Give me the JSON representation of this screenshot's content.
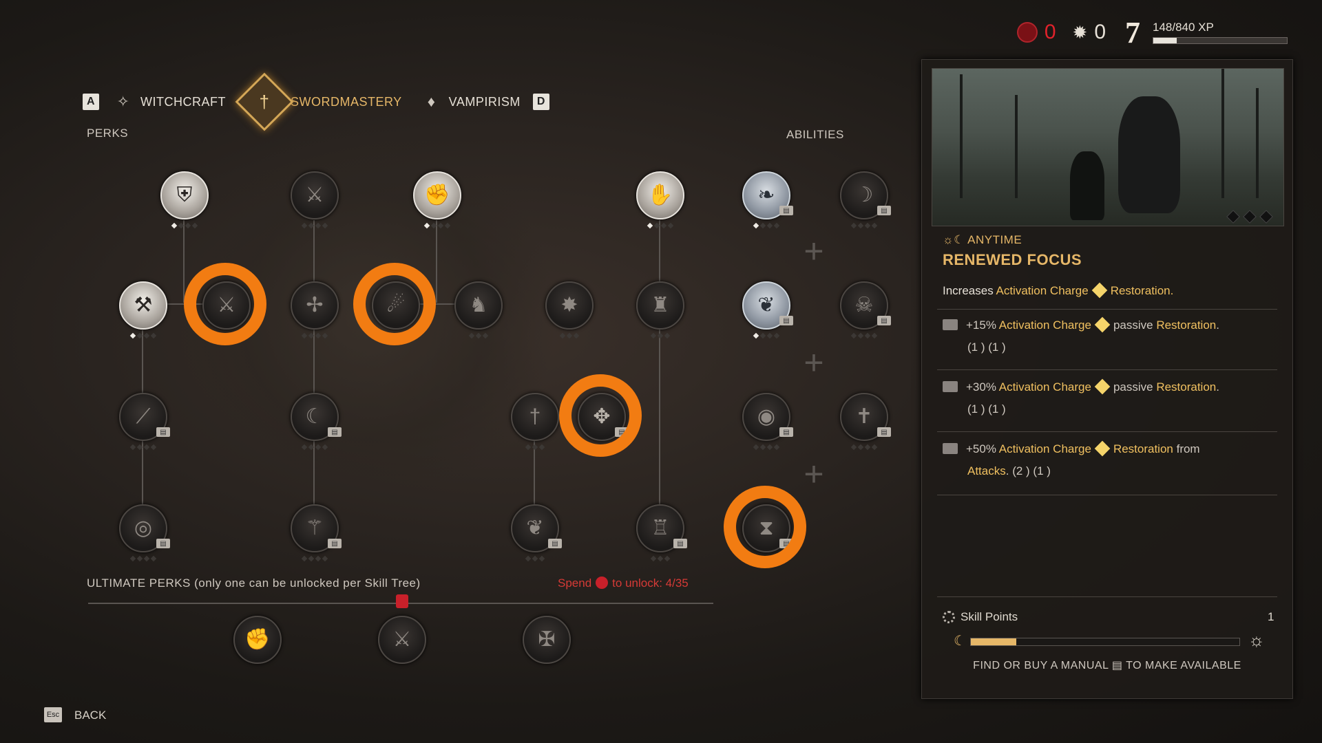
{
  "resources": {
    "blood": "0",
    "gear": "0",
    "level": "7",
    "xp": "148/840 XP",
    "xp_progress": 0.176
  },
  "tabs": {
    "key_left": "A",
    "key_right": "D",
    "items": [
      "WITCHCRAFT",
      "SWORDMASTERY",
      "VAMPIRISM"
    ],
    "active": "SWORDMASTERY"
  },
  "sections": {
    "perks": "PERKS",
    "abilities": "ABILITIES"
  },
  "ultimate": {
    "label": "ULTIMATE PERKS (only one can be unlocked per Skill Tree)",
    "spend_prefix": "Spend",
    "spend_suffix": "to unlock: 4/35"
  },
  "back": {
    "key": "Esc",
    "label": "BACK"
  },
  "panel": {
    "timing": "ANYTIME",
    "title": "RENEWED FOCUS",
    "desc_prefix": "Increases",
    "desc_term1": "Activation Charge",
    "desc_term2": "Restoration.",
    "rows": [
      {
        "pct": "+15%",
        "term1": "Activation Charge",
        "mid": "passive",
        "term2": "Restoration",
        "end": ".",
        "cost": "(1 ) (1 )"
      },
      {
        "pct": "+30%",
        "term1": "Activation Charge",
        "mid": "passive",
        "term2": "Restoration",
        "end": ".",
        "cost": "(1 ) (1 )"
      },
      {
        "pct": "+50%",
        "term1": "Activation Charge",
        "mid": "",
        "term2": "Restoration",
        "end": " from",
        "term3": "Attacks",
        "cost": ". (2 ) (1 )"
      }
    ],
    "skill_points_label": "Skill Points",
    "skill_points_value": "1",
    "manual_prefix": "FIND OR BUY A MANUAL",
    "manual_suffix": "TO MAKE AVAILABLE",
    "slider_progress": 0.17
  },
  "colors": {
    "accent_gold": "#e6b768",
    "highlight_ring": "#f27c12",
    "blood_red": "#e0222b"
  }
}
